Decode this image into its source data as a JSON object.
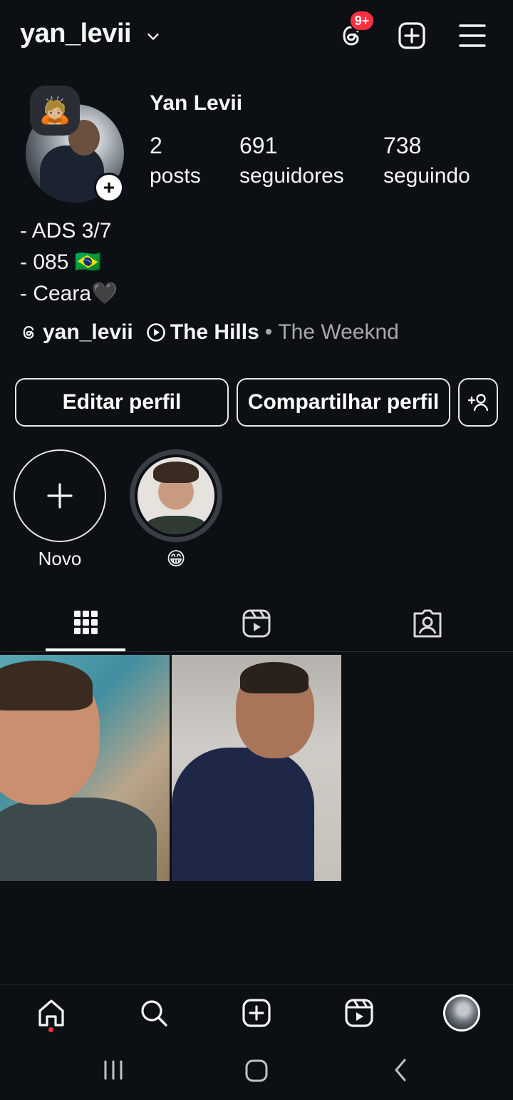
{
  "header": {
    "username": "yan_levii",
    "notification_badge": "9+",
    "icons": [
      "chevron-down-icon",
      "threads-icon",
      "new-post-icon",
      "menu-icon"
    ]
  },
  "profile": {
    "note_emoji": "🙇🏼",
    "full_name": "Yan Levii",
    "stats": [
      {
        "value": "2",
        "label": "posts"
      },
      {
        "value": "691",
        "label": "seguidores"
      },
      {
        "value": "738",
        "label": "seguindo"
      }
    ],
    "bio": [
      "- ADS 3/7",
      "- 085 🇧🇷",
      "- Ceara🖤"
    ],
    "threads_handle": "yan_levii",
    "song_title": "The Hills",
    "song_separator": "•",
    "song_artist": "The Weeknd"
  },
  "actions": {
    "edit_profile": "Editar perfil",
    "share_profile": "Compartilhar perfil"
  },
  "highlights": [
    {
      "label": "Novo"
    },
    {
      "label": "😁"
    }
  ],
  "tabs": [
    "posts-grid",
    "reels",
    "tagged"
  ],
  "colors": {
    "background": "#0c0f14",
    "badge": "#ff3040",
    "text": "#f5f5f5",
    "muted": "#a8a8a8"
  }
}
